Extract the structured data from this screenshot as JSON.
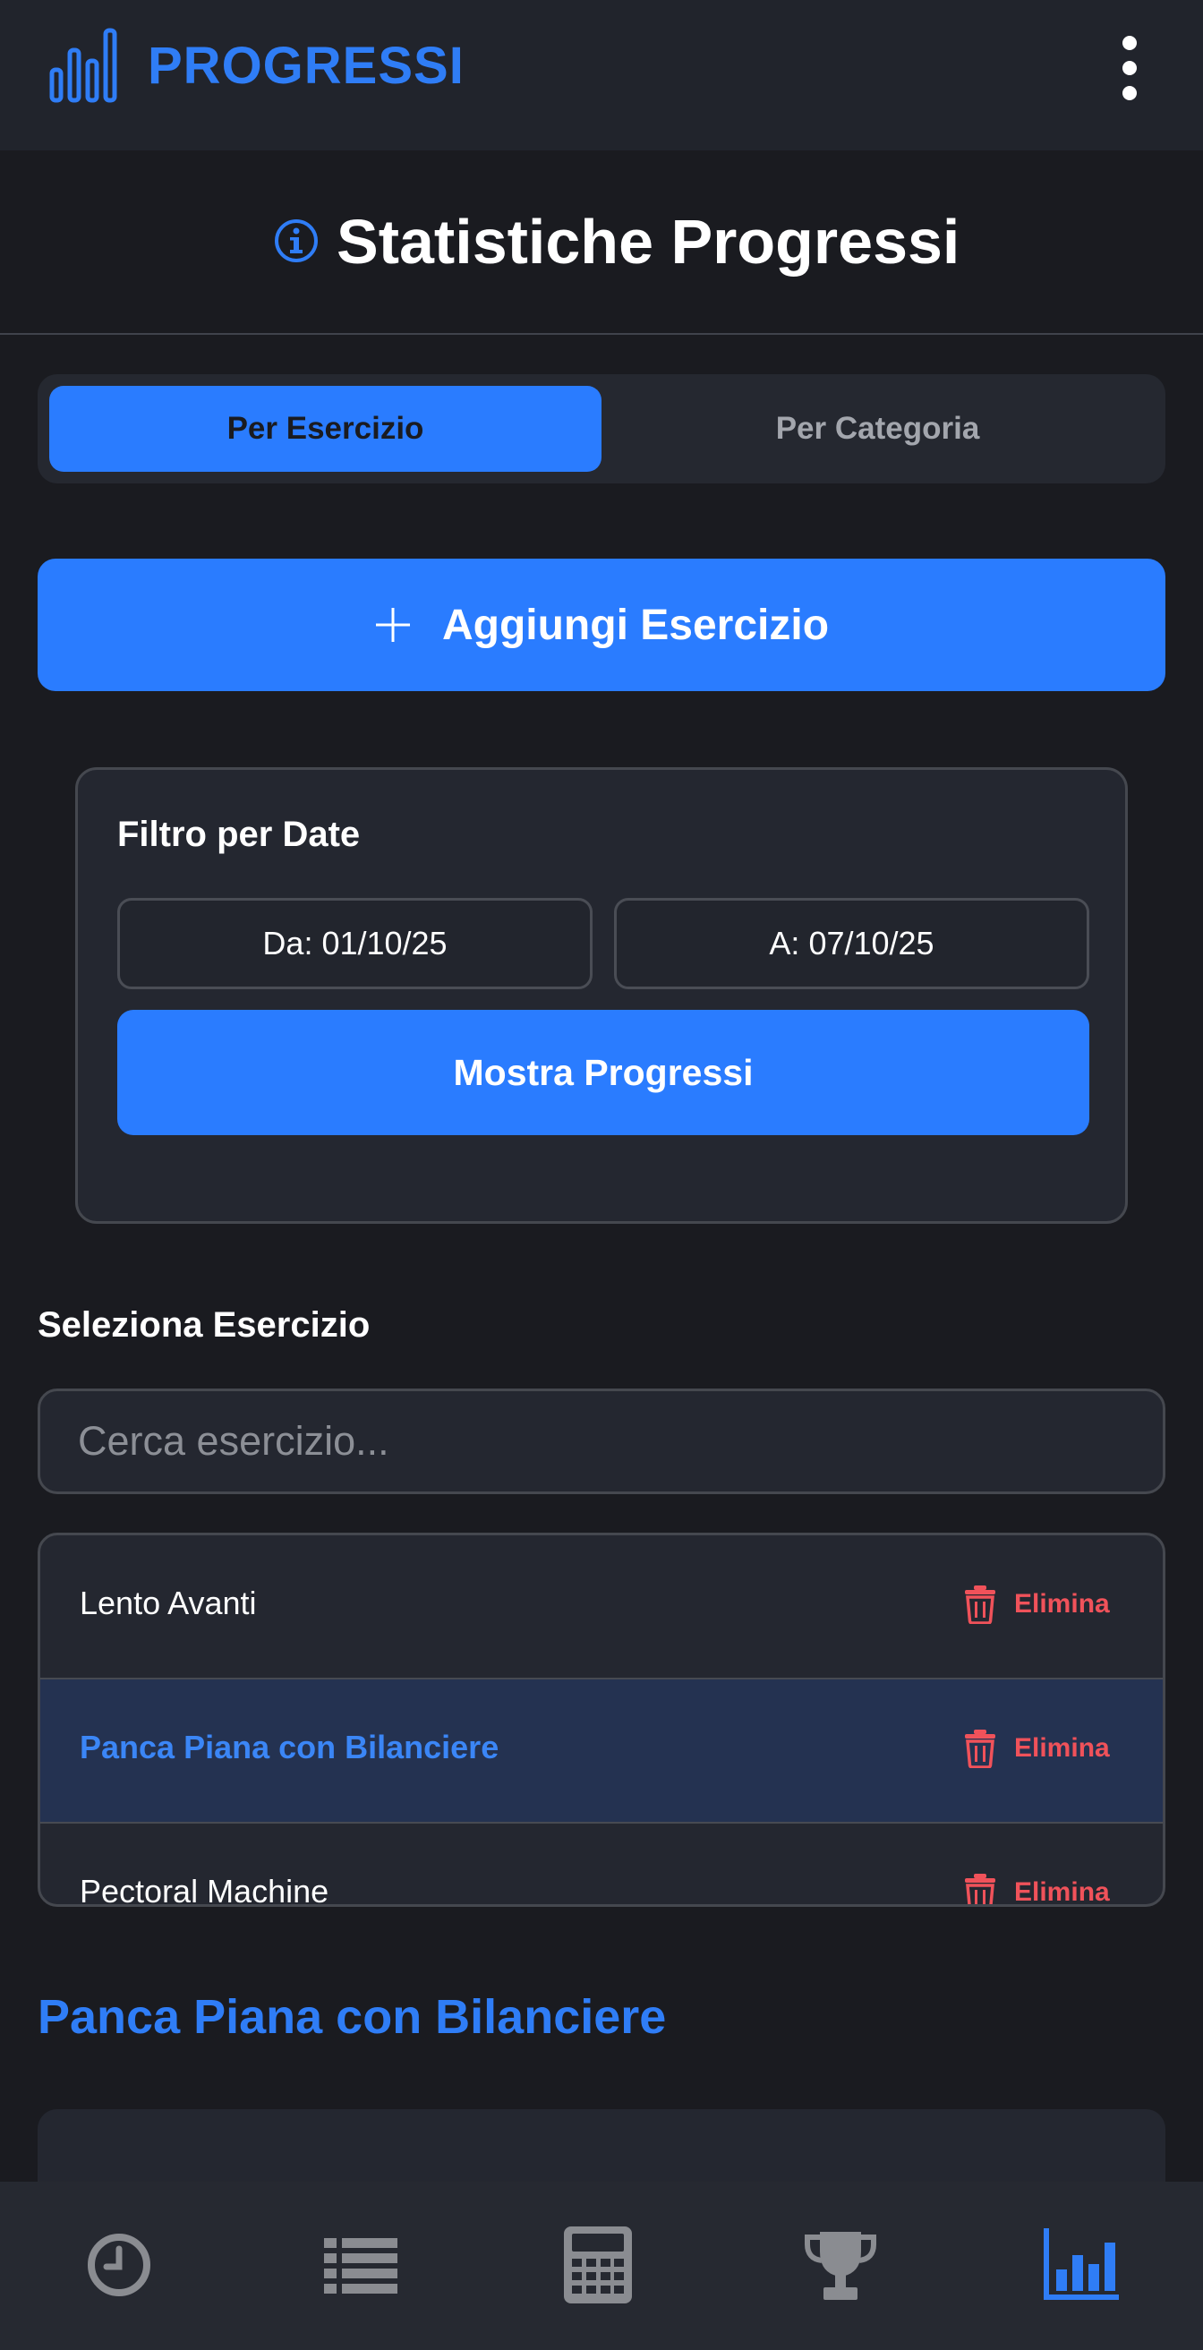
{
  "header": {
    "brand": "PROGRESSI",
    "accent": "#2f7df6"
  },
  "page": {
    "title": "Statistiche Progressi"
  },
  "tabs": [
    {
      "label": "Per Esercizio",
      "active": true
    },
    {
      "label": "Per Categoria",
      "active": false
    }
  ],
  "add_button": {
    "label": "Aggiungi Esercizio"
  },
  "date_filter": {
    "title": "Filtro per Date",
    "from": "Da: 01/10/25",
    "to": "A: 07/10/25",
    "submit_label": "Mostra Progressi"
  },
  "exercise_select": {
    "label": "Seleziona Esercizio",
    "search_placeholder": "Cerca esercizio...",
    "items": [
      {
        "name": "Lento Avanti",
        "delete_label": "Elimina",
        "selected": false
      },
      {
        "name": "Panca Piana con Bilanciere",
        "delete_label": "Elimina",
        "selected": true
      },
      {
        "name": "Pectoral Machine",
        "delete_label": "Elimina",
        "selected": false
      }
    ]
  },
  "selected_exercise": {
    "title": "Panca Piana con Bilanciere"
  },
  "bottom_nav": [
    {
      "icon": "clock-icon",
      "active": false
    },
    {
      "icon": "list-icon",
      "active": false
    },
    {
      "icon": "calculator-icon",
      "active": false
    },
    {
      "icon": "trophy-icon",
      "active": false
    },
    {
      "icon": "bar-chart-icon",
      "active": true
    }
  ],
  "colors": {
    "primary": "#2a7cff",
    "danger": "#f0525a",
    "background": "#1a1b20",
    "inactive_icon": "#8a8c91"
  }
}
